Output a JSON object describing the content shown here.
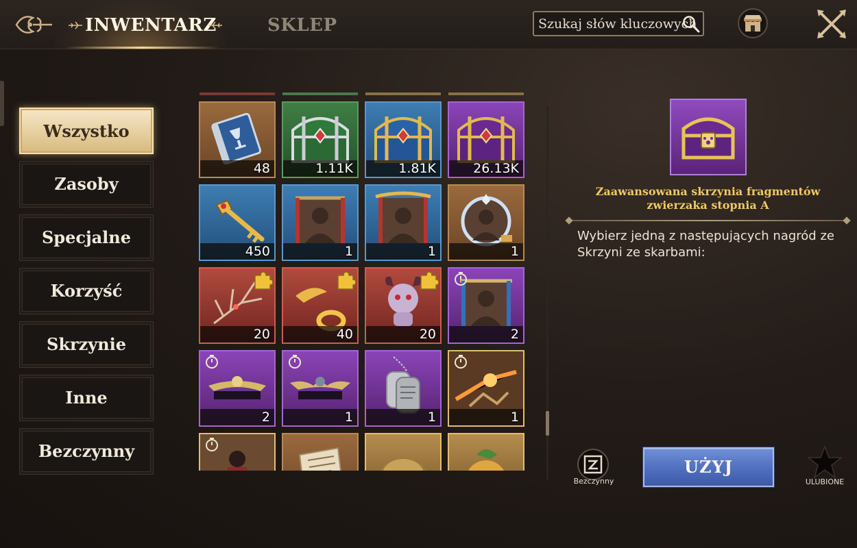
{
  "header": {
    "tabs": [
      {
        "label": "INWENTARZ",
        "active": true
      },
      {
        "label": "SKLEP",
        "active": false
      }
    ],
    "search": {
      "placeholder": "Szukaj słów kluczowych",
      "icon": "search-icon"
    },
    "shop_icon": "shop-icon",
    "close_icon": "close-icon"
  },
  "categories": [
    {
      "label": "Wszystko",
      "active": true
    },
    {
      "label": "Zasoby",
      "active": false
    },
    {
      "label": "Specjalne",
      "active": false
    },
    {
      "label": "Korzyść",
      "active": false
    },
    {
      "label": "Skrzynie",
      "active": false
    },
    {
      "label": "Inne",
      "active": false
    },
    {
      "label": "Bezczynny",
      "active": false
    }
  ],
  "items": [
    {
      "rarity": "orange",
      "icon": "book-icon",
      "qty": "48"
    },
    {
      "rarity": "green",
      "icon": "chest-icon",
      "qty": "1.11K"
    },
    {
      "rarity": "blue",
      "icon": "chest-icon",
      "qty": "1.81K"
    },
    {
      "rarity": "purple",
      "icon": "chest-icon",
      "qty": "26.13K"
    },
    {
      "rarity": "blue",
      "icon": "key-icon",
      "qty": "450"
    },
    {
      "rarity": "blue",
      "icon": "portrait-frame-icon",
      "qty": "1"
    },
    {
      "rarity": "blue",
      "icon": "portrait-frame-icon",
      "qty": "1"
    },
    {
      "rarity": "orange",
      "icon": "portrait-frame-icon",
      "qty": "1"
    },
    {
      "rarity": "red",
      "icon": "branch-icon",
      "qty": "20",
      "puzzle": true
    },
    {
      "rarity": "red",
      "icon": "gold-ring-icon",
      "qty": "40",
      "puzzle": true
    },
    {
      "rarity": "red",
      "icon": "creature-icon",
      "qty": "20",
      "puzzle": true
    },
    {
      "rarity": "purple",
      "icon": "portrait-frame-icon",
      "qty": "2",
      "timer": true
    },
    {
      "rarity": "purple",
      "icon": "nameplate-icon",
      "qty": "2",
      "timer": true
    },
    {
      "rarity": "purple",
      "icon": "nameplate-icon",
      "qty": "1",
      "timer": true
    },
    {
      "rarity": "purple",
      "icon": "dog-tag-icon",
      "qty": "1"
    },
    {
      "rarity": "gold",
      "icon": "battle-scene-icon",
      "qty": "1",
      "timer": true
    },
    {
      "rarity": "gold",
      "icon": "character-icon",
      "qty": "",
      "timer": true
    },
    {
      "rarity": "orange",
      "icon": "scroll-icon",
      "qty": ""
    },
    {
      "rarity": "gold",
      "icon": "seed-pile-icon",
      "qty": ""
    },
    {
      "rarity": "gold",
      "icon": "fruit-icon",
      "qty": ""
    }
  ],
  "detail": {
    "icon": "pet-chest-icon",
    "title": "Zaawansowana skrzynia fragmentów zwierzaka stopnia A",
    "description": "Wybierz jedną z następujących nagród ze Skrzyni ze skarbami:"
  },
  "actions": {
    "idle_label": "Bezczynny",
    "use_label": "UŻYJ",
    "favorite_label": "ULUBIONE"
  },
  "colors": {
    "accent_gold": "#f0c964",
    "use_button": "#5a78c6",
    "rarity_orange": "#9a6a3e",
    "rarity_green": "#3f7f45",
    "rarity_blue": "#3d7db3",
    "rarity_purple": "#8a44b8",
    "rarity_red": "#b24a3e",
    "rarity_gold": "#b58c4d"
  }
}
